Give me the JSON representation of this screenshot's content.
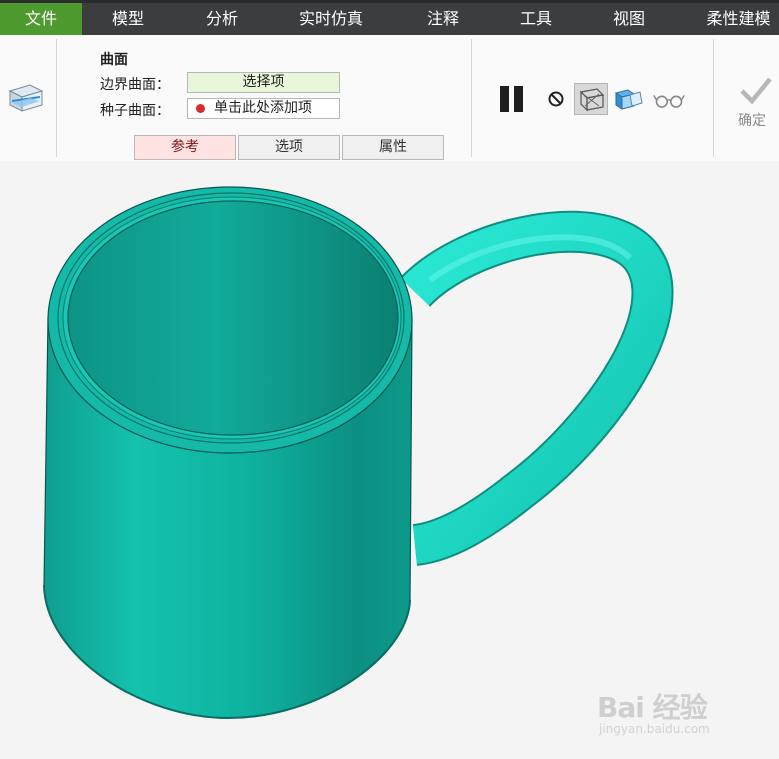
{
  "menu": {
    "items": [
      "文件",
      "模型",
      "分析",
      "实时仿真",
      "注释",
      "工具",
      "视图",
      "柔性建模"
    ],
    "active_index": 0
  },
  "ribbon": {
    "section_title": "曲面",
    "boundary_label": "边界曲面：",
    "boundary_value": "选择项",
    "seed_label": "种子曲面：",
    "seed_value": "单击此处添加项",
    "tabs": [
      "参考",
      "选项",
      "属性"
    ],
    "active_tab": 0,
    "ok_label": "确定"
  },
  "icons": {
    "feature": "surface-copy-icon",
    "pause": "pause-icon",
    "stop": "no-preview-icon",
    "preview_geometry": "preview-geometry-icon",
    "preview_feature": "preview-feature-icon",
    "verify": "verify-glasses-icon",
    "ok": "checkmark-icon"
  },
  "watermark": {
    "brand": "Bai 经验",
    "url": "jingyan.baidu.com"
  },
  "colors": {
    "menu_bg": "#3b3d3f",
    "menu_active": "#4f9a2f",
    "model_teal": "#0fb8a6",
    "handle_teal": "#27e6d3"
  }
}
